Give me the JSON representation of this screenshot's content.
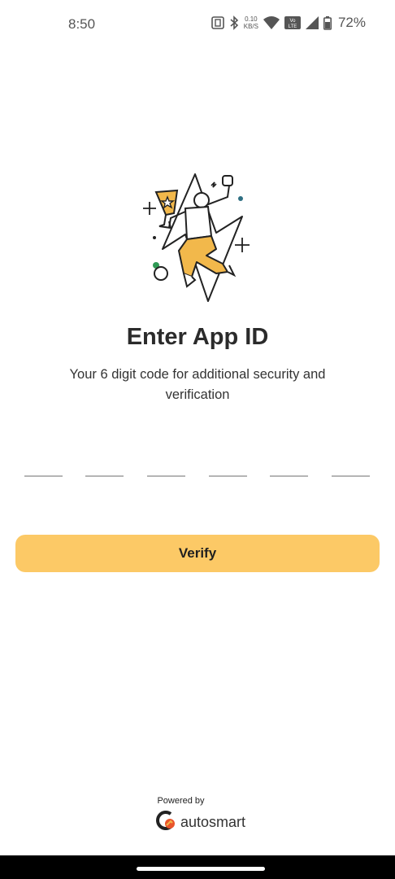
{
  "status_bar": {
    "time": "8:50",
    "net_speed_value": "0.10",
    "net_speed_unit": "KB/S",
    "volte": "Vo LTE",
    "battery": "72%"
  },
  "screen": {
    "title": "Enter App ID",
    "subtitle": "Your 6 digit code for additional security and verification",
    "otp_digits": [
      "",
      "",
      "",
      "",
      "",
      ""
    ]
  },
  "actions": {
    "verify_label": "Verify"
  },
  "footer": {
    "powered_by": "Powered by",
    "brand_name": "autosmart"
  },
  "colors": {
    "accent": "#fcc966",
    "illustration_fill": "#f2b84b",
    "nav_bar": "#000000"
  },
  "icons": {
    "status": [
      "nfc-icon",
      "bluetooth-icon",
      "wifi-icon",
      "volte-icon",
      "signal-icon",
      "battery-icon"
    ],
    "hero": "trophy-celebration-illustration",
    "brand": "autosmart-logo"
  }
}
